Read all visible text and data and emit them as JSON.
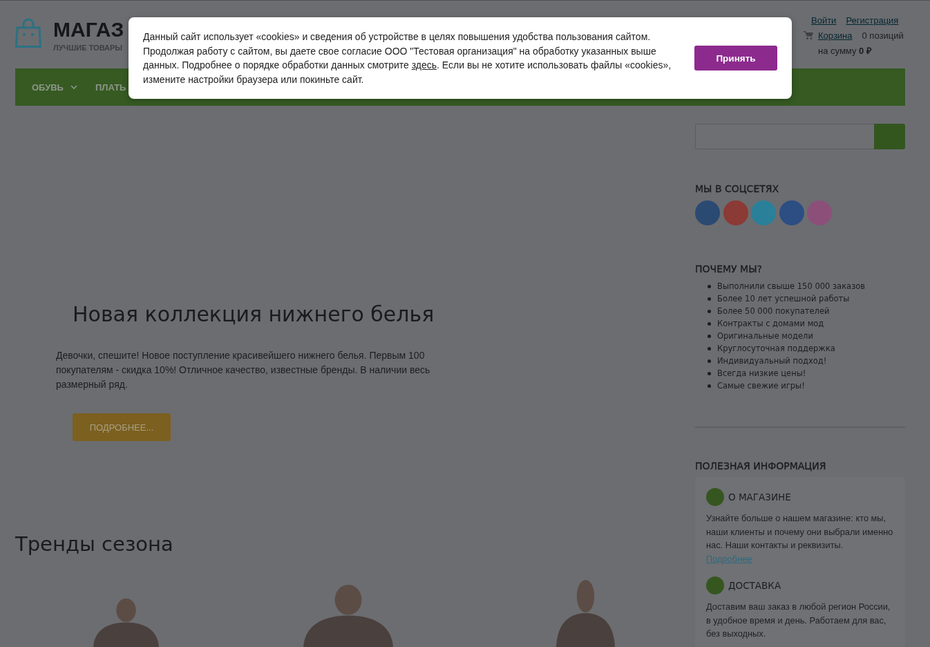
{
  "header": {
    "logo": {
      "title": "МАГАЗ",
      "tagline": "ЛУЧШИЕ ТОВАРЫ"
    },
    "account_links": [
      {
        "label": "Войти"
      },
      {
        "label": "Регистрация"
      }
    ],
    "cart": {
      "link": "Корзина",
      "count": "0 позиций",
      "total": "на сумму **0 ₽**"
    }
  },
  "nav": [
    {
      "label": "ОБУВЬ",
      "dropdown": true
    },
    {
      "label": "ПЛАТЬ",
      "dropdown": false
    }
  ],
  "hero": {
    "title": "Новая коллекция нижнего белья",
    "text": "Девочки, спешите! Новое поступление красивейшего нижнего белья. Первым 100 покупателям - скидка 10%! Отличное качество, известные бренды. В наличии весь размерный ряд.",
    "button": "ПОДРОБНЕЕ..."
  },
  "trends": {
    "title": "Тренды сезона",
    "products": [
      {
        "kind": "photo"
      },
      {
        "kind": "photo"
      },
      {
        "kind": "photo"
      }
    ]
  },
  "sidebar": {
    "socials": {
      "title": "МЫ В СОЦСЕТЯХ",
      "links": [
        {
          "color": "#2b4a72"
        },
        {
          "color": "#8b3a35"
        },
        {
          "color": "#2a8099"
        },
        {
          "color": "#2c4e82"
        },
        {
          "color": "#8c4f7a"
        }
      ]
    },
    "why_us": {
      "title": "ПОЧЕМУ МЫ?",
      "items": [
        "Выполнили свыше 150 000 заказов",
        "Более 10 лет успешной работы",
        "Более 50 000 покупателей",
        "Контракты с домами мод",
        "Оригинальные модели",
        "Круглосуточная поддержка",
        "Индивидуальный подход!",
        "Всегда низкие цены!",
        "Самые свежие игры!"
      ]
    },
    "info": {
      "title": "ПОЛЕЗНАЯ ИНФОРМАЦИЯ",
      "articles": [
        {
          "title": "О МАГАЗИНЕ",
          "text": "Узнайте больше о нашем магазине: кто мы, наши клиенты и почему они выбрали именно нас. Наши контакты и реквизиты.",
          "link": "Подробнее"
        },
        {
          "title": "ДОСТАВКА",
          "text": "Доставим ваш заказ в любой регион России, в удобное время и день. Работаем для вас, без выходных."
        }
      ]
    }
  },
  "cookie_banner": {
    "text": [
      {
        "kind": "text",
        "text": "Данный сайт использует «cookies» и сведения об устройстве в целях повышения удобства пользования сайтом. Продолжая работу с сайтом, вы даете свое согласие ООО \"Тестовая организация\" на обработку указанных выше данных. Подробнее о порядке обработки данных смотрите "
      },
      {
        "kind": "link",
        "text": "здесь"
      },
      {
        "kind": "text",
        "text": ". Если вы не хотите использовать файлы «cookies», измените настройки браузера или покиньте сайт."
      }
    ],
    "button": "Принять"
  }
}
